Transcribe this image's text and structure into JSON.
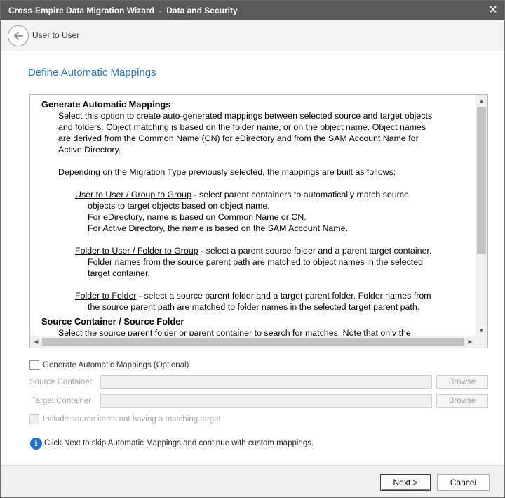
{
  "window": {
    "title": "Cross-Empire Data Migration Wizard  -  Data and Security",
    "close_glyph": "✕"
  },
  "nav": {
    "back_label": "User to User"
  },
  "page": {
    "title": "Define Automatic Mappings"
  },
  "help": {
    "heading1": "Generate Automatic Mappings",
    "p1_lines": [
      "Select this option to create auto-generated mappings between selected source and target objects",
      "and folders.  Object matching is based on the folder name, or on the object name.  Object names",
      "are derived from the Common Name (CN) for eDirectory and from the SAM Account Name for",
      "Active Directory."
    ],
    "p2": "Depending on the Migration Type previously selected, the mappings are built as follows:",
    "item1": {
      "link": "User to User / Group to Group",
      "text": "  -  select parent containers to automatically match source",
      "cont": [
        "objects to target objects based on object name.",
        "For eDirectory, name is based on Common Name or CN.",
        "For Active Directory, the name is based on the SAM Account Name."
      ]
    },
    "item2": {
      "link": "Folder to User / Folder to Group",
      "text": "  -  select a parent source folder and a parent target container.",
      "cont": [
        "Folder names from the source parent path are matched to object names in the selected",
        "target container."
      ]
    },
    "item3": {
      "link": "Folder to Folder",
      "text": "  -  select a source parent folder and a target parent folder.  Folder names from",
      "cont": [
        "the source parent path are matched to folder names in the selected target parent path."
      ]
    },
    "heading2": "Source Container / Source Folder",
    "p3_partial": "Select the source parent folder or parent container to search for matches.  Note that only the"
  },
  "form": {
    "generate_label": "Generate Automatic Mappings (Optional)",
    "generate_checked": false,
    "source_label": "Source Container",
    "source_value": "",
    "target_label": "Target Container",
    "target_value": "",
    "browse_label": "Browse",
    "include_label": "Include source items not having a matching target",
    "include_checked": false
  },
  "info": {
    "icon_glyph": "i",
    "text": "Click Next to skip Automatic Mappings and continue with custom mappings."
  },
  "footer": {
    "next_label": "Next >",
    "cancel_label": "Cancel"
  },
  "colors": {
    "titlebar": "#5a5a5a",
    "accent": "#2e75b6",
    "info": "#1f6fc5"
  }
}
